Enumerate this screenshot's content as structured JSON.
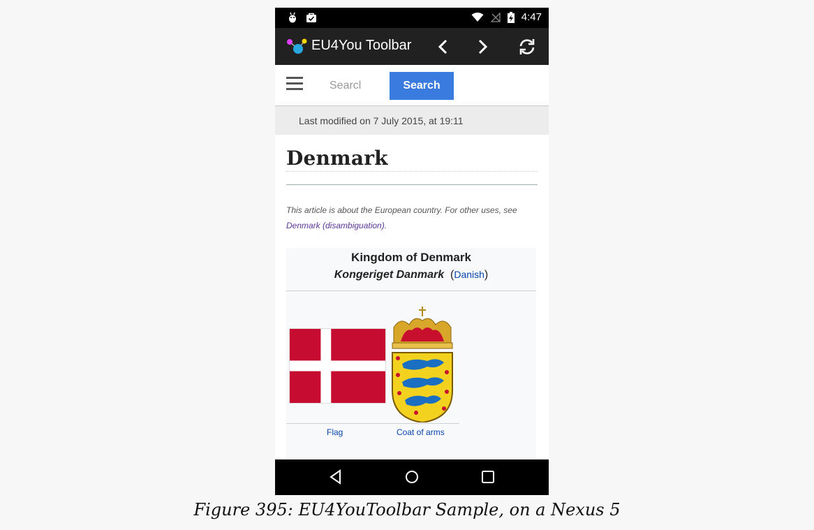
{
  "status_bar": {
    "time": "4:47"
  },
  "app_bar": {
    "title": "EU4You Toolbar"
  },
  "search": {
    "placeholder": "Searcl",
    "button_label": "Search"
  },
  "last_modified": "Last modified on 7 July 2015, at 19:11",
  "article": {
    "title": "Denmark",
    "hatnote_text": "This article is about the European country. For other uses, see ",
    "hatnote_link": "Denmark (disambiguation)",
    "hatnote_end": "."
  },
  "infobox": {
    "name": "Kingdom of Denmark",
    "native_name": "Kongeriget Danmark",
    "language_link": "Danish",
    "flag_caption": "Flag",
    "coat_caption": "Coat of arms"
  },
  "caption": "Figure 395: EU4YouToolbar Sample, on a Nexus 5",
  "colors": {
    "app_bar": "#212121",
    "search_button": "#3a7bdf",
    "link": "#0645ad",
    "visited_link": "#5a3696",
    "flag_red": "#c60c30"
  }
}
